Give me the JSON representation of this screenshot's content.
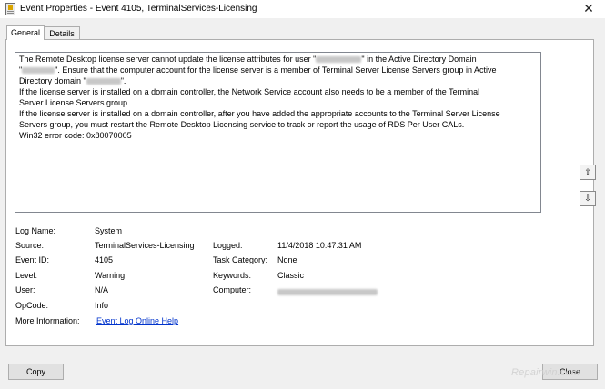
{
  "window": {
    "title": "Event Properties - Event 4105, TerminalServices-Licensing",
    "close_glyph": "✕"
  },
  "tabs": [
    {
      "label": "General",
      "active": true
    },
    {
      "label": "Details",
      "active": false
    }
  ],
  "description": {
    "line1a": "The Remote Desktop license server cannot update the license attributes for user \"",
    "line1b": "\" in the Active Directory Domain",
    "line2a": "\"",
    "line2b": "\". Ensure that the computer account for the license server is a member of Terminal Server License Servers group in Active",
    "line3a": "Directory domain \"",
    "line3b": "\".",
    "line4": "If the license server is installed on a domain controller, the Network Service account also needs to be a member of the Terminal",
    "line5": "Server License Servers group.",
    "line6": "If the license server is installed on a domain controller, after you have added the appropriate accounts to the Terminal Server License",
    "line7": "Servers group, you must restart the Remote Desktop Licensing service to track or report the usage of RDS Per User CALs.",
    "line8": "Win32 error code: 0x80070005"
  },
  "fields": {
    "log_name_label": "Log Name:",
    "log_name_value": "System",
    "source_label": "Source:",
    "source_value": "TerminalServices-Licensing",
    "logged_label": "Logged:",
    "logged_value": "11/4/2018 10:47:31 AM",
    "event_id_label": "Event ID:",
    "event_id_value": "4105",
    "task_category_label": "Task Category:",
    "task_category_value": "None",
    "level_label": "Level:",
    "level_value": "Warning",
    "keywords_label": "Keywords:",
    "keywords_value": "Classic",
    "user_label": "User:",
    "user_value": "N/A",
    "computer_label": "Computer:",
    "opcode_label": "OpCode:",
    "opcode_value": "Info",
    "more_info_label": "More Information:",
    "more_info_link": "Event Log Online Help"
  },
  "buttons": {
    "copy": "Copy",
    "close": "Close",
    "up_arrow": "⇧",
    "down_arrow": "⇩"
  },
  "watermark": "Repairwin.com"
}
